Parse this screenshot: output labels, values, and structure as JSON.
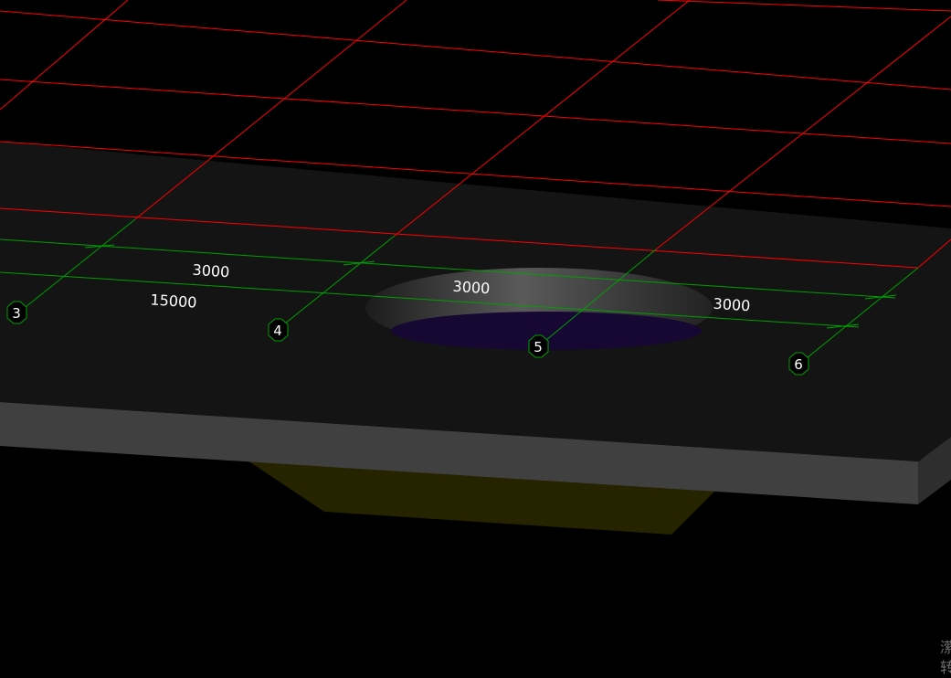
{
  "viewport": {
    "background": "#000000"
  },
  "colors": {
    "grid_lines": "#ff0000",
    "axis_lines": "#00a000",
    "slab_top": "#141414",
    "slab_edge": "#404040",
    "column_beneath": "#262300",
    "hole_floor": "#160733"
  },
  "axes": [
    {
      "label": "3"
    },
    {
      "label": "4"
    },
    {
      "label": "5"
    },
    {
      "label": "6"
    }
  ],
  "dimensions": {
    "segments": [
      "3000",
      "3000",
      "3000"
    ],
    "total": "15000"
  },
  "corner_hint": {
    "text": "潆转"
  }
}
